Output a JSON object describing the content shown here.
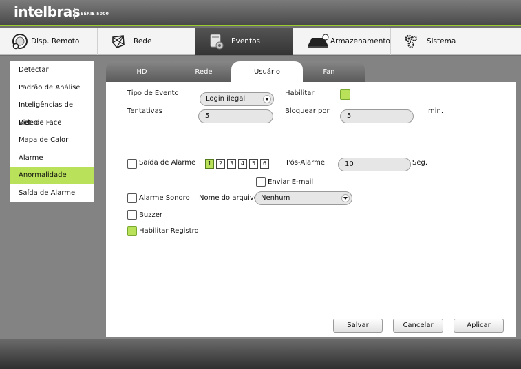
{
  "header": {
    "brand": "intelbras",
    "series": "SÉRIE 5000"
  },
  "nav": [
    {
      "label": "Disp. Remoto",
      "icon": "remote-device-icon",
      "active": false
    },
    {
      "label": "Rede",
      "icon": "network-icon",
      "active": false
    },
    {
      "label": "Eventos",
      "icon": "events-icon",
      "active": true
    },
    {
      "label": "Armazenamento",
      "icon": "storage-icon",
      "active": false
    },
    {
      "label": "Sistema",
      "icon": "system-gears-icon",
      "active": false
    }
  ],
  "sidebar": {
    "items": [
      {
        "label": "Detectar",
        "active": false
      },
      {
        "label": "Padrão de Análise",
        "active": false
      },
      {
        "label": "Inteligências de Video",
        "active": false
      },
      {
        "label": "Det. de Face",
        "active": false
      },
      {
        "label": "Mapa de Calor",
        "active": false
      },
      {
        "label": "Alarme",
        "active": false
      },
      {
        "label": "Anormalidade",
        "active": true
      },
      {
        "label": "Saída de Alarme",
        "active": false
      }
    ]
  },
  "tabs": [
    {
      "label": "HD",
      "active": false
    },
    {
      "label": "Rede",
      "active": false
    },
    {
      "label": "Usuário",
      "active": true
    },
    {
      "label": "Fan",
      "active": false
    }
  ],
  "form": {
    "event_type_label": "Tipo de Evento",
    "event_type_value": "Login ilegal",
    "enable_label": "Habilitar",
    "enable_checked": true,
    "attempts_label": "Tentativas",
    "attempts_value": "5",
    "block_for_label": "Bloquear por",
    "block_for_value": "5",
    "block_unit": "min.",
    "alarm_output_label": "Saída de Alarme",
    "alarm_output_checked": false,
    "alarm_channels": [
      {
        "label": "1",
        "selected": true
      },
      {
        "label": "2",
        "selected": false
      },
      {
        "label": "3",
        "selected": false
      },
      {
        "label": "4",
        "selected": false
      },
      {
        "label": "5",
        "selected": false
      },
      {
        "label": "6",
        "selected": false
      }
    ],
    "post_alarm_label": "Pós-Alarme",
    "post_alarm_value": "10",
    "post_alarm_unit": "Seg.",
    "send_email_label": "Enviar E-mail",
    "send_email_checked": false,
    "sound_alarm_label": "Alarme Sonoro",
    "sound_alarm_checked": false,
    "file_name_label": "Nome do arquivo",
    "file_name_value": "Nenhum",
    "buzzer_label": "Buzzer",
    "buzzer_checked": false,
    "enable_log_label": "Habilitar Registro",
    "enable_log_checked": true
  },
  "buttons": {
    "save": "Salvar",
    "cancel": "Cancelar",
    "apply": "Aplicar"
  },
  "colors": {
    "accent": "#b9e25a",
    "active_nav": "#3c3c3c"
  }
}
